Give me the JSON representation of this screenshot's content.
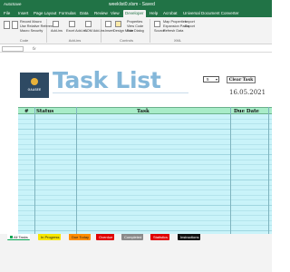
{
  "window": {
    "title": "weeklist0.xlsm - Saved",
    "autosave": "AutoSave"
  },
  "ribbon": {
    "tabs": [
      "File",
      "Insert",
      "Page Layout",
      "Formulas",
      "Data",
      "Review",
      "View",
      "Developer",
      "Help",
      "Acrobat",
      "Universal Document Converter"
    ],
    "active_tab": "Developer",
    "groups": {
      "code": {
        "label": "Code",
        "items": [
          "Record Macro",
          "Use Relative References",
          "Macro Security"
        ]
      },
      "addins": {
        "label": "Add-ins",
        "items": [
          "Add-ins",
          "Excel Add-ins",
          "COM Add-ins"
        ]
      },
      "controls": {
        "label": "Controls",
        "items": [
          "Insert",
          "Design Mode",
          "Properties",
          "View Code",
          "Run Dialog"
        ]
      },
      "xml": {
        "label": "XML",
        "items": [
          "Source",
          "Map Properties",
          "Expansion Packs",
          "Refresh Data",
          "Import",
          "Export"
        ]
      }
    }
  },
  "formula_bar": {
    "name_box": "",
    "fx": "fx"
  },
  "sheet": {
    "logo_text": "GAASEE",
    "title": "Task List",
    "dropdown_value": "5",
    "clear_button": "Clear Task",
    "date": "16.05.2021",
    "table": {
      "headers": {
        "num": "#",
        "status": "Status",
        "task": "Task",
        "due": "Due Date"
      }
    }
  },
  "sheet_tabs": [
    {
      "label": "All Tasks",
      "color": "#ffffff",
      "swatch": "#00a651"
    },
    {
      "label": "In Progress",
      "color": "#ffffff",
      "swatch": "#f7e600"
    },
    {
      "label": "Due Today",
      "color": "#ffffff",
      "swatch": "#ff8c00"
    },
    {
      "label": "Overdue",
      "color": "#ffffff",
      "swatch": "#e00000"
    },
    {
      "label": "Completed",
      "color": "#ffffff",
      "swatch": "#8a8a8a"
    },
    {
      "label": "Statistics",
      "color": "#ffffff",
      "swatch": "#e00000"
    },
    {
      "label": "Instructions",
      "color": "#ffffff",
      "swatch": "#111111"
    }
  ],
  "colors": {
    "excel_green": "#217346",
    "header_green": "#a8ecc8",
    "body_cyan": "#c9f3f9",
    "title_blue": "#84b7d9"
  }
}
